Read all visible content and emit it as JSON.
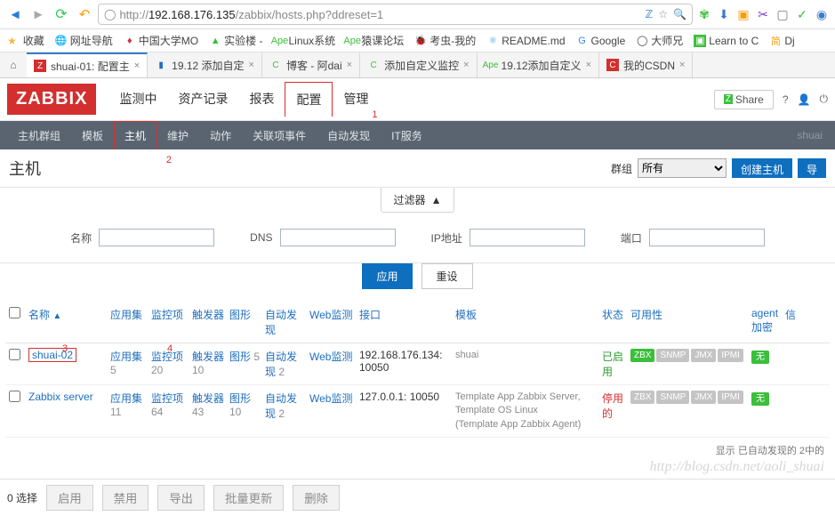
{
  "browser": {
    "url_prefix": "http://",
    "url_host": "192.168.176.135",
    "url_path": "/zabbix/hosts.php?ddreset=1"
  },
  "bookmarks": {
    "fav_label": "收藏",
    "items": [
      "网址导航",
      "中国大学MO",
      "实验楼 -",
      "Linux系统",
      "猿课论坛",
      "考虫-我的",
      "README.md",
      "Google",
      "大师兄",
      "Learn to C",
      "Dj"
    ]
  },
  "tabs": [
    {
      "label": "shuai-01: 配置主",
      "active": true
    },
    {
      "label": "19.12 添加自定"
    },
    {
      "label": "博客 - 阿dai"
    },
    {
      "label": "添加自定义监控"
    },
    {
      "label": "19.12添加自定义"
    },
    {
      "label": "我的CSDN"
    }
  ],
  "header": {
    "logo": "ZABBIX",
    "menu": [
      "监测中",
      "资产记录",
      "报表",
      "配置",
      "管理"
    ],
    "share": "Share",
    "ann1": "1",
    "ann2": "2",
    "ann3": "3",
    "ann4": "4"
  },
  "submenu": {
    "items": [
      "主机群组",
      "模板",
      "主机",
      "维护",
      "动作",
      "关联项事件",
      "自动发现",
      "IT服务"
    ],
    "right": "shuai"
  },
  "title_row": {
    "title": "主机",
    "group_label": "群组",
    "group_value": "所有",
    "create_btn": "创建主机",
    "import_btn": "导"
  },
  "filter": {
    "tab_label": "过滤器",
    "name": "名称",
    "dns": "DNS",
    "ip": "IP地址",
    "port": "端口",
    "apply": "应用",
    "reset": "重设"
  },
  "table": {
    "headers": {
      "name": "名称",
      "app": "应用集",
      "item": "监控项",
      "trig": "触发器",
      "graph": "图形",
      "disc": "自动发现",
      "web": "Web监测",
      "iface": "接口",
      "tmpl": "模板",
      "stat": "状态",
      "avail": "可用性",
      "agent": "agent 加密",
      "info": "信"
    },
    "rows": [
      {
        "name": "shuai-02",
        "app": "应用集",
        "app_n": "5",
        "item": "监控项",
        "item_n": "20",
        "trig": "触发器",
        "trig_n": "10",
        "graph": "图形",
        "graph_n": "5",
        "disc": "自动发现",
        "disc_n": "2",
        "web": "Web监测",
        "iface": "192.168.176.134: 10050",
        "tmpl": "shuai",
        "status": "已启用",
        "status_cls": "en",
        "zbx_on": true,
        "enc": "无"
      },
      {
        "name": "Zabbix server",
        "app": "应用集",
        "app_n": "11",
        "item": "监控项",
        "item_n": "64",
        "trig": "触发器",
        "trig_n": "43",
        "graph": "图形",
        "graph_n": "10",
        "disc": "自动发现",
        "disc_n": "2",
        "web": "Web监测",
        "iface": "127.0.0.1: 10050",
        "tmpl": "Template App Zabbix Server, Template OS Linux",
        "tmpl2": "(Template App Zabbix Agent)",
        "status": "停用的",
        "status_cls": "dis",
        "zbx_on": false,
        "enc": "无"
      }
    ]
  },
  "footer": {
    "displaying": "显示 已自动发现的 2中的",
    "csdn": "http://blog.csdn.net/aoli_shuai",
    "selected": "0 选择",
    "bulk": [
      "启用",
      "禁用",
      "导出",
      "批量更新",
      "删除"
    ]
  }
}
